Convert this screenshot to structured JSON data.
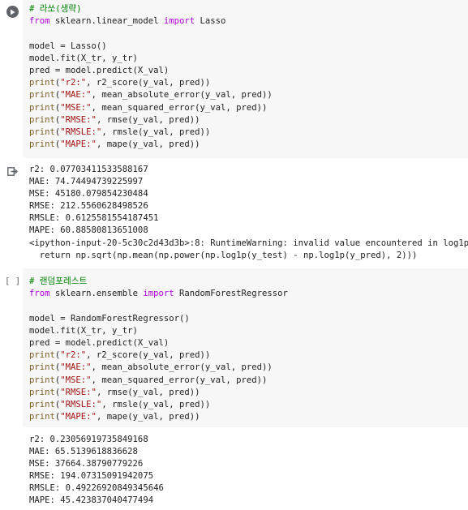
{
  "cell1": {
    "code": [
      [
        {
          "t": "# 라쏘(생략)",
          "c": "cm"
        }
      ],
      [
        {
          "t": "from",
          "c": "kw"
        },
        {
          "t": " sklearn.linear_model ",
          "c": "pl"
        },
        {
          "t": "import",
          "c": "kw"
        },
        {
          "t": " Lasso",
          "c": "pl"
        }
      ],
      [
        {
          "t": "",
          "c": "pl"
        }
      ],
      [
        {
          "t": "model = Lasso()",
          "c": "pl"
        }
      ],
      [
        {
          "t": "model.fit(X_tr, y_tr)",
          "c": "pl"
        }
      ],
      [
        {
          "t": "pred = model.predict(X_val)",
          "c": "pl"
        }
      ],
      [
        {
          "t": "print",
          "c": "fn"
        },
        {
          "t": "(",
          "c": "pl"
        },
        {
          "t": "\"r2:\"",
          "c": "str"
        },
        {
          "t": ", r2_score(y_val, pred))",
          "c": "pl"
        }
      ],
      [
        {
          "t": "print",
          "c": "fn"
        },
        {
          "t": "(",
          "c": "pl"
        },
        {
          "t": "\"MAE:\"",
          "c": "str"
        },
        {
          "t": ", mean_absolute_error(y_val, pred))",
          "c": "pl"
        }
      ],
      [
        {
          "t": "print",
          "c": "fn"
        },
        {
          "t": "(",
          "c": "pl"
        },
        {
          "t": "\"MSE:\"",
          "c": "str"
        },
        {
          "t": ", mean_squared_error(y_val, pred))",
          "c": "pl"
        }
      ],
      [
        {
          "t": "print",
          "c": "fn"
        },
        {
          "t": "(",
          "c": "pl"
        },
        {
          "t": "\"RMSE:\"",
          "c": "str"
        },
        {
          "t": ", rmse(y_val, pred))",
          "c": "pl"
        }
      ],
      [
        {
          "t": "print",
          "c": "fn"
        },
        {
          "t": "(",
          "c": "pl"
        },
        {
          "t": "\"RMSLE:\"",
          "c": "str"
        },
        {
          "t": ", rmsle(y_val, pred))",
          "c": "pl"
        }
      ],
      [
        {
          "t": "print",
          "c": "fn"
        },
        {
          "t": "(",
          "c": "pl"
        },
        {
          "t": "\"MAPE:\"",
          "c": "str"
        },
        {
          "t": ", mape(y_val, pred))",
          "c": "pl"
        }
      ]
    ],
    "output": [
      "r2: 0.07703411533588167",
      "MAE: 74.74494739225997",
      "MSE: 45180.079854230484",
      "RMSE: 212.5560628498526",
      "RMSLE: 0.6125581554187451",
      "MAPE: 60.88580813651008",
      "<ipython-input-20-5c30c2d43d3b>:8: RuntimeWarning: invalid value encountered in log1p",
      "  return np.sqrt(np.mean(np.power(np.log1p(y_test) - np.log1p(y_pred), 2)))"
    ]
  },
  "cell2": {
    "exec_count": "[ ]",
    "code": [
      [
        {
          "t": "# 랜덤포레스트",
          "c": "cm"
        }
      ],
      [
        {
          "t": "from",
          "c": "kw"
        },
        {
          "t": " sklearn.ensemble ",
          "c": "pl"
        },
        {
          "t": "import",
          "c": "kw"
        },
        {
          "t": " RandomForestRegressor",
          "c": "pl"
        }
      ],
      [
        {
          "t": "",
          "c": "pl"
        }
      ],
      [
        {
          "t": "model = RandomForestRegressor()",
          "c": "pl"
        }
      ],
      [
        {
          "t": "model.fit(X_tr, y_tr)",
          "c": "pl"
        }
      ],
      [
        {
          "t": "pred = model.predict(X_val)",
          "c": "pl"
        }
      ],
      [
        {
          "t": "print",
          "c": "fn"
        },
        {
          "t": "(",
          "c": "pl"
        },
        {
          "t": "\"r2:\"",
          "c": "str"
        },
        {
          "t": ", r2_score(y_val, pred))",
          "c": "pl"
        }
      ],
      [
        {
          "t": "print",
          "c": "fn"
        },
        {
          "t": "(",
          "c": "pl"
        },
        {
          "t": "\"MAE:\"",
          "c": "str"
        },
        {
          "t": ", mean_absolute_error(y_val, pred))",
          "c": "pl"
        }
      ],
      [
        {
          "t": "print",
          "c": "fn"
        },
        {
          "t": "(",
          "c": "pl"
        },
        {
          "t": "\"MSE:\"",
          "c": "str"
        },
        {
          "t": ", mean_squared_error(y_val, pred))",
          "c": "pl"
        }
      ],
      [
        {
          "t": "print",
          "c": "fn"
        },
        {
          "t": "(",
          "c": "pl"
        },
        {
          "t": "\"RMSE:\"",
          "c": "str"
        },
        {
          "t": ", rmse(y_val, pred))",
          "c": "pl"
        }
      ],
      [
        {
          "t": "print",
          "c": "fn"
        },
        {
          "t": "(",
          "c": "pl"
        },
        {
          "t": "\"RMSLE:\"",
          "c": "str"
        },
        {
          "t": ", rmsle(y_val, pred))",
          "c": "pl"
        }
      ],
      [
        {
          "t": "print",
          "c": "fn"
        },
        {
          "t": "(",
          "c": "pl"
        },
        {
          "t": "\"MAPE:\"",
          "c": "str"
        },
        {
          "t": ", mape(y_val, pred))",
          "c": "pl"
        }
      ]
    ],
    "output": [
      "r2: 0.23056919735849168",
      "MAE: 65.5139618836628",
      "MSE: 37664.38790779226",
      "RMSE: 194.07315091942075",
      "RMSLE: 0.49226920849345646",
      "MAPE: 45.423837040477494"
    ]
  },
  "icons": {
    "run": "play-icon",
    "output": "output-arrow-icon"
  },
  "colors": {
    "keyword": "#af00db",
    "string": "#a31515",
    "function": "#795e26",
    "comment": "#008000",
    "code_bg": "#f7f7f7"
  }
}
